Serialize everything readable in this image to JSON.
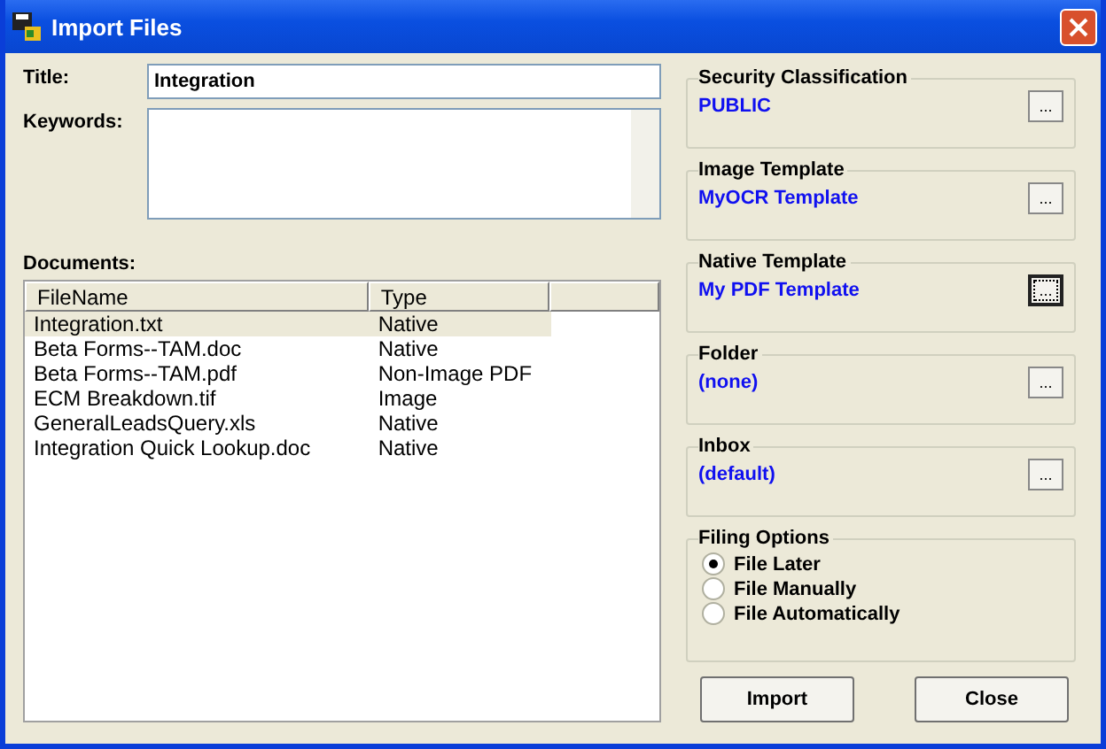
{
  "window": {
    "title": "Import Files"
  },
  "title_field": {
    "label": "Title:",
    "value": "Integration"
  },
  "keywords_field": {
    "label": "Keywords:"
  },
  "documents": {
    "label": "Documents:",
    "columns": [
      "FileName",
      "Type"
    ],
    "rows": [
      {
        "cells": [
          "Integration.txt",
          "Native"
        ],
        "selected": true
      },
      {
        "cells": [
          "Beta Forms--TAM.doc",
          "Native"
        ],
        "selected": false
      },
      {
        "cells": [
          "Beta Forms--TAM.pdf",
          "Non-Image PDF"
        ],
        "selected": false
      },
      {
        "cells": [
          "ECM Breakdown.tif",
          "Image"
        ],
        "selected": false
      },
      {
        "cells": [
          "GeneralLeadsQuery.xls",
          "Native"
        ],
        "selected": false
      },
      {
        "cells": [
          "Integration Quick Lookup.doc",
          "Native"
        ],
        "selected": false
      }
    ]
  },
  "groups": [
    {
      "title": "Security Classification",
      "value": "PUBLIC",
      "button": "...",
      "focused": false
    },
    {
      "title": "Image Template",
      "value": "MyOCR Template",
      "button": "...",
      "focused": false
    },
    {
      "title": "Native Template",
      "value": "My PDF Template",
      "button": "...",
      "focused": true
    },
    {
      "title": "Folder",
      "value": "(none)",
      "button": "...",
      "focused": false
    },
    {
      "title": "Inbox",
      "value": "(default)",
      "button": "...",
      "focused": false
    }
  ],
  "filing_options": {
    "title": "Filing Options",
    "options": [
      {
        "label": "File Later",
        "selected": true
      },
      {
        "label": "File Manually",
        "selected": false
      },
      {
        "label": "File Automatically",
        "selected": false
      }
    ]
  },
  "buttons": [
    "Import",
    "Close"
  ]
}
